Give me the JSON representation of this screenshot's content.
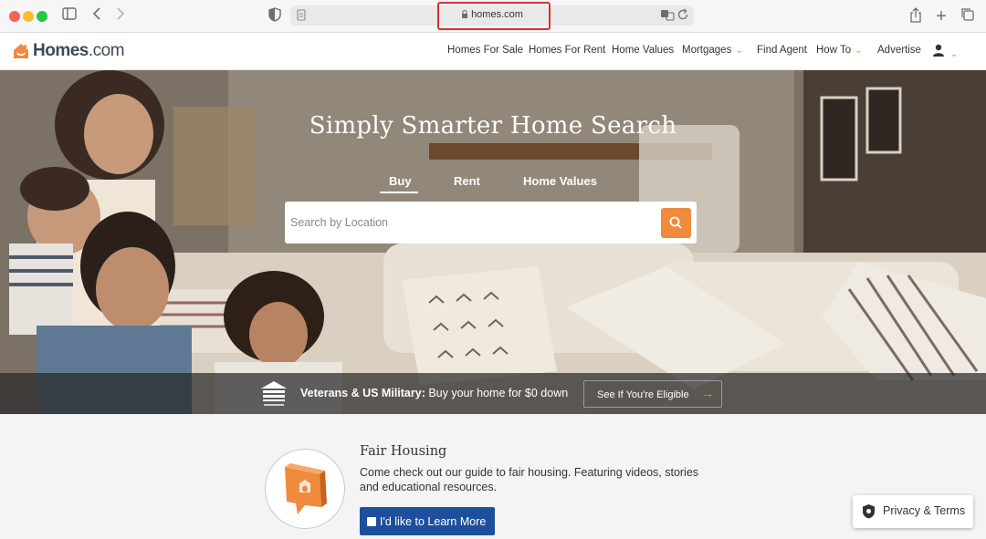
{
  "browser": {
    "url": "homes.com"
  },
  "header": {
    "logo_text": "Homes",
    "logo_suffix": ".com",
    "nav": [
      {
        "label": "Homes For Sale"
      },
      {
        "label": "Homes For Rent"
      },
      {
        "label": "Home Values"
      },
      {
        "label": "Mortgages",
        "dropdown": true
      },
      {
        "label": "Find Agent"
      },
      {
        "label": "How To",
        "dropdown": true
      },
      {
        "label": "Advertise"
      }
    ]
  },
  "hero": {
    "title": "Simply Smarter Home Search",
    "tabs": [
      {
        "label": "Buy",
        "active": true
      },
      {
        "label": "Rent",
        "active": false
      },
      {
        "label": "Home Values",
        "active": false
      }
    ],
    "search_placeholder": "Search by Location"
  },
  "banner": {
    "bold": "Veterans & US Military:",
    "text": " Buy your home for $0 down",
    "button_label": "See If You're Eligible"
  },
  "fair_housing": {
    "title": "Fair Housing",
    "body": "Come check out our guide to fair housing. Featuring videos, stories and educational resources.",
    "button_label": "I'd like to Learn More"
  },
  "privacy": {
    "label": "Privacy & Terms"
  },
  "colors": {
    "accent": "#f08a3c",
    "primary_button": "#1d4f9c",
    "highlight": "#e02d2d"
  }
}
